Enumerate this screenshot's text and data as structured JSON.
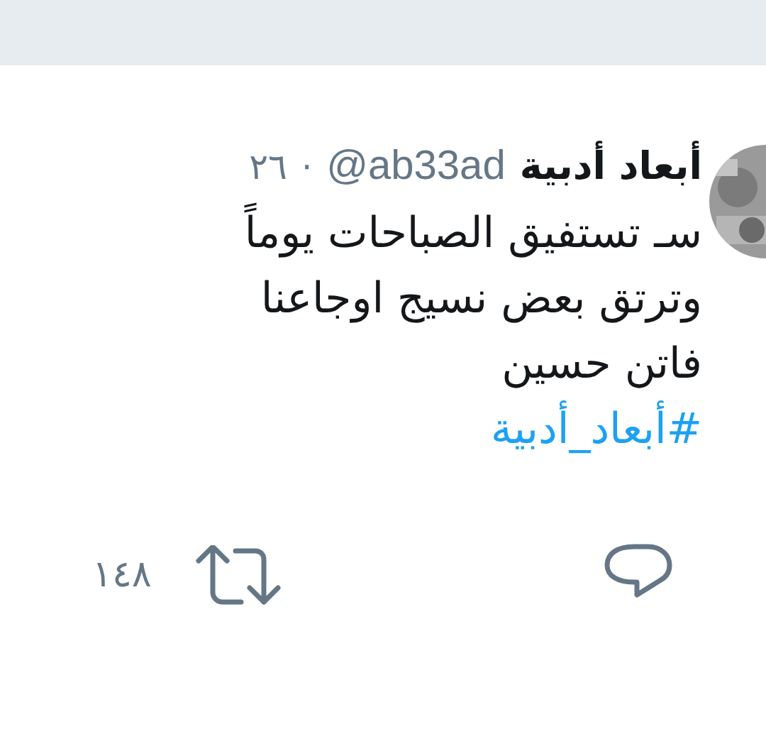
{
  "tweet": {
    "author_name": "أبعاد أدبية",
    "handle": "@ab33ad",
    "separator": "·",
    "time": "٢٦",
    "text": "سـ تستفيق الصباحات يوماً\nوترتق بعض نسيج اوجاعنا\nفاتن حسين",
    "hashtag": "#أبعاد_أدبية",
    "retweet_count": "١٤٨"
  }
}
